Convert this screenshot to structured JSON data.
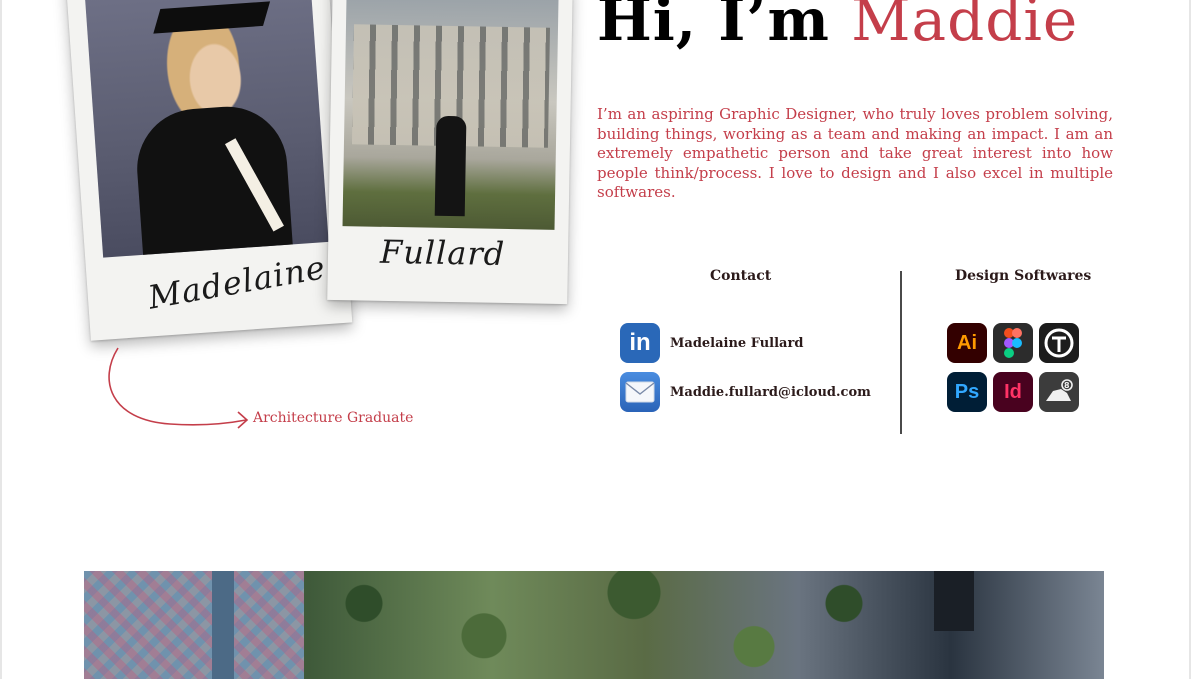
{
  "polaroids": [
    {
      "caption": "Madelaine"
    },
    {
      "caption": "Fullard"
    }
  ],
  "arch_label": "Architecture Graduate",
  "hero": {
    "greeting": "Hi, I’m ",
    "name": "Maddie",
    "bio": "I’m an aspiring Graphic Designer, who truly loves problem solving, building things, working as a team and making an impact. I am an extremely empathetic person and take great interest into how people think/process. I love to design and I also excel in multiple softwares."
  },
  "contact": {
    "heading": "Contact",
    "items": [
      {
        "icon": "linkedin-icon",
        "label": "Madelaine Fullard"
      },
      {
        "icon": "mail-icon",
        "label": "Maddie.fullard@icloud.com"
      }
    ]
  },
  "software": {
    "heading": "Design Softwares",
    "items": [
      {
        "icon": "illustrator-icon",
        "text": "Ai"
      },
      {
        "icon": "figma-icon",
        "text": ""
      },
      {
        "icon": "sketchup-icon",
        "text": ""
      },
      {
        "icon": "photoshop-icon",
        "text": "Ps"
      },
      {
        "icon": "indesign-icon",
        "text": "Id"
      },
      {
        "icon": "rhino-icon",
        "text": ""
      }
    ]
  },
  "colors": {
    "accent": "#c43e4a",
    "text": "#2b1a1a"
  }
}
